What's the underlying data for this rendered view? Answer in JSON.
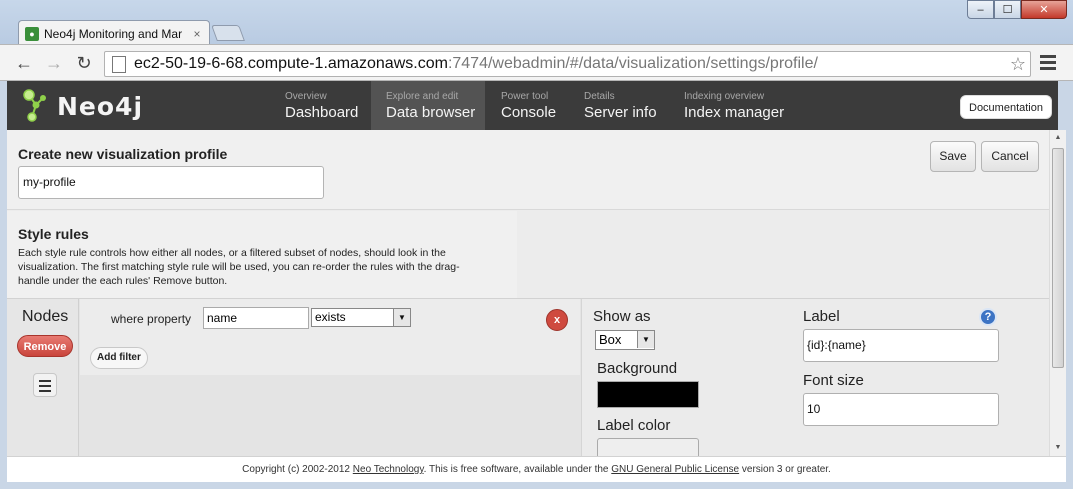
{
  "browser": {
    "tab_title": "Neo4j Monitoring and Mar",
    "tab_close": "×",
    "url_host": "ec2-50-19-6-68.compute-1.amazonaws.com",
    "url_rest": ":7474/webadmin/#/data/visualization/settings/profile/",
    "back_icon": "←",
    "forward_icon": "→",
    "reload_icon": "↻",
    "star_icon": "☆",
    "minimize": "–",
    "maximize": "☐",
    "close": "✕"
  },
  "header": {
    "logo_text": "Neo4j",
    "nav": [
      {
        "small": "Overview",
        "big": "Dashboard"
      },
      {
        "small": "Explore and edit",
        "big": "Data browser"
      },
      {
        "small": "Power tool",
        "big": "Console"
      },
      {
        "small": "Details",
        "big": "Server info"
      },
      {
        "small": "Indexing overview",
        "big": "Index manager"
      }
    ],
    "documentation_label": "Documentation"
  },
  "profile": {
    "heading": "Create new visualization profile",
    "name_value": "my-profile",
    "save_label": "Save",
    "cancel_label": "Cancel"
  },
  "style_rules": {
    "heading": "Style rules",
    "description": "Each style rule controls how either all nodes, or a filtered subset of nodes, should look in the visualization. The first matching style rule will be used, you can re-order the rules with the drag-handle under the each rules' Remove button."
  },
  "rule": {
    "title": "Nodes",
    "remove_label": "Remove",
    "filter_label": "where property",
    "filter_property": "name",
    "filter_operator": "exists",
    "remove_filter_label": "x",
    "add_filter_label": "Add filter",
    "show_as_label": "Show as",
    "show_as_value": "Box",
    "background_label": "Background",
    "background_color": "#000000",
    "label_color_label": "Label color",
    "label_color": "#eeeeee",
    "label_label": "Label",
    "label_value": "{id}:{name}",
    "font_size_label": "Font size",
    "font_size_value": "10",
    "help_icon": "?"
  },
  "footer": {
    "prefix": "Copyright (c) 2002-2012 ",
    "neo_link": "Neo Technology",
    "middle": ". This is free software, available under the ",
    "gpl_link": "GNU General Public License",
    "suffix": " version 3 or greater."
  },
  "colors": {
    "header_bg": "#3b3b3b",
    "remove_red": "#c9453c",
    "logo_green": "#8fd04a"
  }
}
